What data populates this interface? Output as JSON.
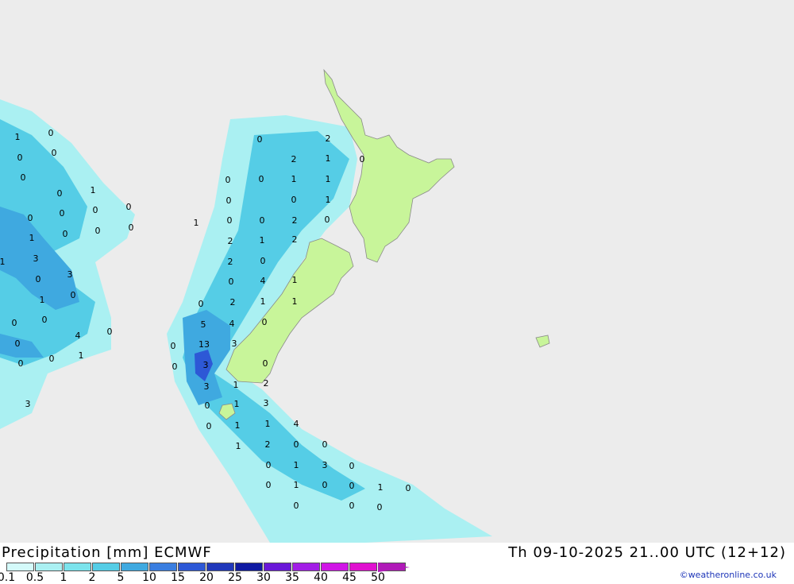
{
  "title": "Precipitation [mm] ECMWF",
  "timestamp": "Th 09-10-2025 21..00 UTC (12+12)",
  "credit": "©weatheronline.co.uk",
  "colors": {
    "sea": "#ececec",
    "land": "#c8f59a",
    "coast": "#8a8a8a"
  },
  "legend": [
    {
      "label": "0.1",
      "color": "#d4fafa"
    },
    {
      "label": "0.5",
      "color": "#aaf0f2"
    },
    {
      "label": "1",
      "color": "#7be3ec"
    },
    {
      "label": "2",
      "color": "#55cde6"
    },
    {
      "label": "5",
      "color": "#3fa9e0"
    },
    {
      "label": "10",
      "color": "#3a7ee0"
    },
    {
      "label": "15",
      "color": "#2d58d6"
    },
    {
      "label": "20",
      "color": "#2038bb"
    },
    {
      "label": "25",
      "color": "#0f1aa2"
    },
    {
      "label": "30",
      "color": "#6a18d8"
    },
    {
      "label": "35",
      "color": "#a21ee6"
    },
    {
      "label": "40",
      "color": "#d016e6"
    },
    {
      "label": "45",
      "color": "#e010d0"
    },
    {
      "label": "50",
      "color": "#b01ab8"
    }
  ],
  "values": [
    "1",
    "0",
    "0",
    "0",
    "0",
    "0",
    "1",
    "0",
    "0",
    "0",
    "1",
    "0",
    "0",
    "0",
    "0",
    "3",
    "1",
    "0",
    "3",
    "1",
    "0",
    "0",
    "0",
    "4",
    "0",
    "0",
    "3",
    "0",
    "1",
    "0",
    "2",
    "0",
    "0",
    "1",
    "2",
    "0",
    "0",
    "1",
    "1",
    "0",
    "0",
    "1",
    "1",
    "0",
    "0",
    "2",
    "0",
    "2",
    "1",
    "2",
    "2",
    "0",
    "0",
    "4",
    "1",
    "0",
    "2",
    "1",
    "1",
    "5",
    "4",
    "0",
    "13",
    "3",
    "0",
    "3",
    "0",
    "0",
    "3",
    "1",
    "2",
    "0",
    "1",
    "3",
    "0",
    "1",
    "1",
    "4",
    "1",
    "2",
    "0",
    "0",
    "0",
    "1",
    "3",
    "0",
    "0",
    "1",
    "0",
    "0",
    "1",
    "0",
    "0",
    "0",
    "0"
  ]
}
